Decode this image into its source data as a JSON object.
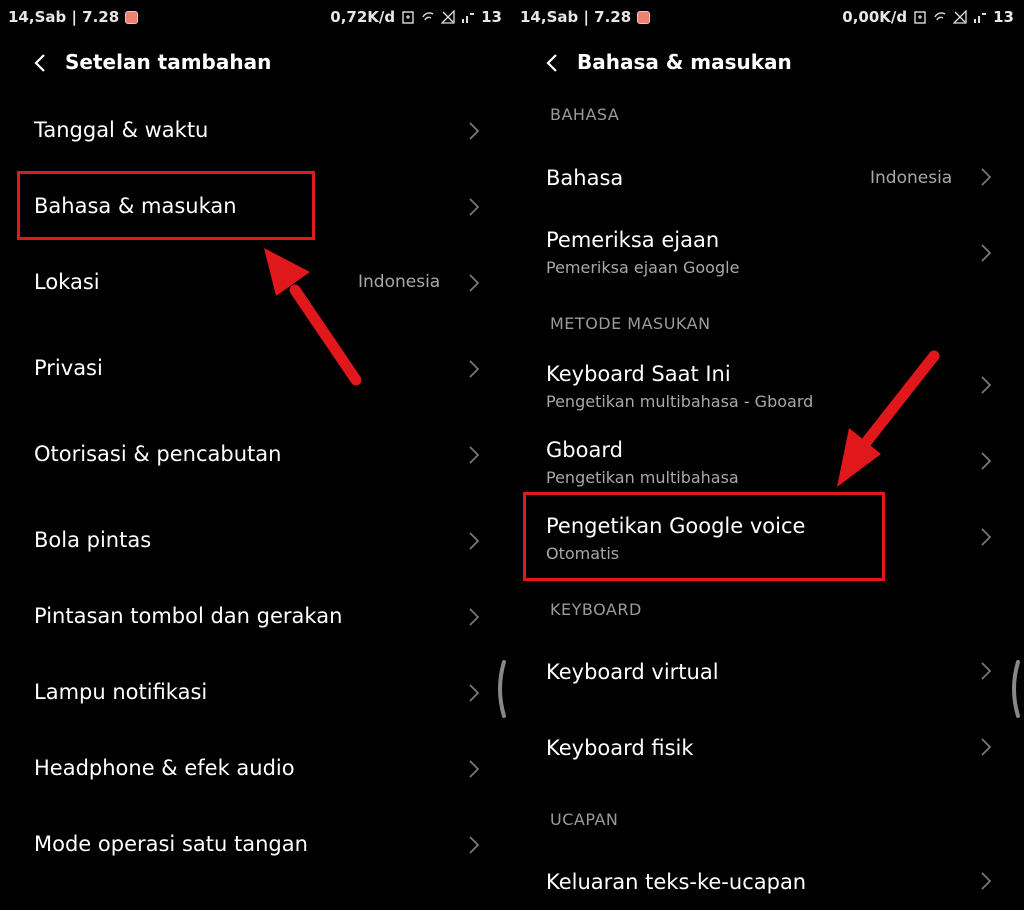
{
  "left_screen": {
    "status": {
      "time": "14,Sab | 7.28",
      "speed": "0,72K/d",
      "battery": "13",
      "icons": [
        "notification-icon",
        "alarm-icon",
        "wifi-icon",
        "no-signal-icon",
        "signal-icon"
      ]
    },
    "header": {
      "title": "Setelan tambahan"
    },
    "items": [
      {
        "label": "Tanggal & waktu"
      },
      {
        "label": "Bahasa & masukan"
      },
      {
        "label": "Lokasi",
        "value": "Indonesia"
      },
      {
        "label": "Privasi"
      },
      {
        "label": "Otorisasi & pencabutan"
      },
      {
        "label": "Bola pintas"
      },
      {
        "label": "Pintasan tombol dan gerakan"
      },
      {
        "label": "Lampu notifikasi"
      },
      {
        "label": "Headphone & efek audio"
      },
      {
        "label": "Mode operasi satu tangan"
      }
    ]
  },
  "right_screen": {
    "status": {
      "time": "14,Sab | 7.28",
      "speed": "0,00K/d",
      "battery": "13"
    },
    "header": {
      "title": "Bahasa & masukan"
    },
    "sections": {
      "language": "BAHASA",
      "input": "METODE MASUKAN",
      "keyboard": "KEYBOARD",
      "speech": "UCAPAN"
    },
    "items": {
      "language": {
        "label": "Bahasa",
        "value": "Indonesia"
      },
      "spellcheck": {
        "label": "Pemeriksa ejaan",
        "sub": "Pemeriksa ejaan Google"
      },
      "current_keyboard": {
        "label": "Keyboard Saat Ini",
        "sub": "Pengetikan multibahasa - Gboard"
      },
      "gboard": {
        "label": "Gboard",
        "sub": "Pengetikan multibahasa"
      },
      "google_voice": {
        "label": "Pengetikan Google voice",
        "sub": "Otomatis"
      },
      "virtual_keyboard": {
        "label": "Keyboard virtual"
      },
      "physical_keyboard": {
        "label": "Keyboard fisik"
      },
      "tts": {
        "label": "Keluaran teks-ke-ucapan"
      }
    }
  },
  "colors": {
    "highlight": "#e0171b",
    "background": "#000000",
    "secondary_text": "#a8a8a8"
  }
}
